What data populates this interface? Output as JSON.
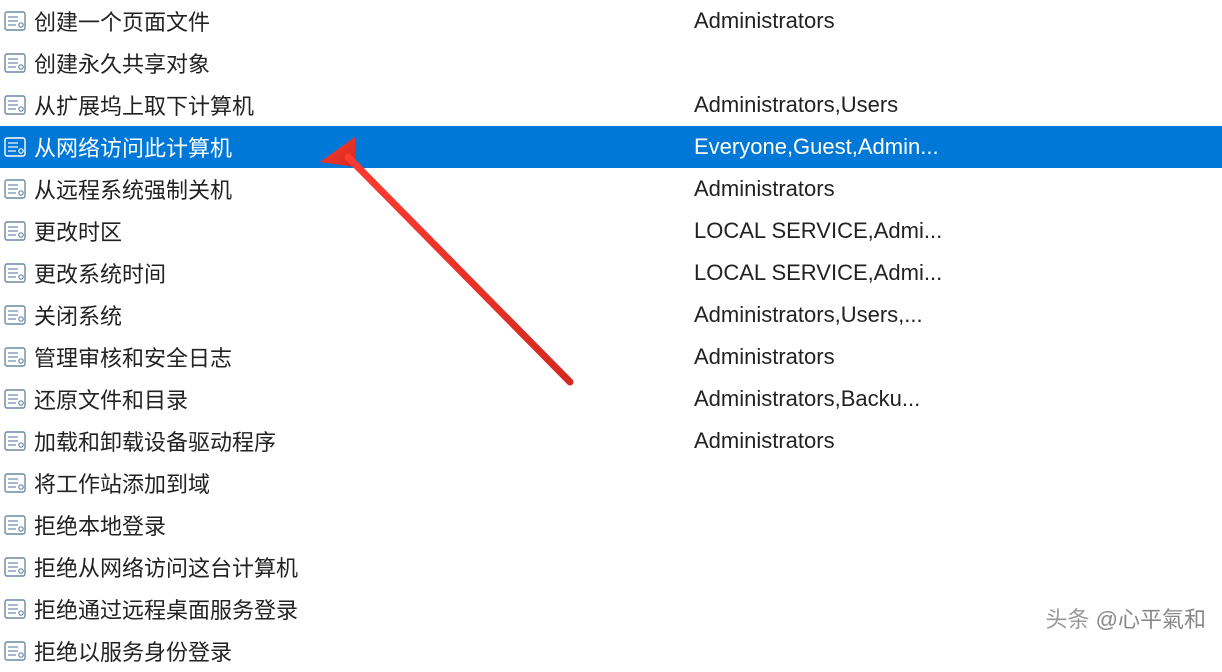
{
  "policies": [
    {
      "name": "创建一个页面文件",
      "value": "Administrators",
      "selected": false
    },
    {
      "name": "创建永久共享对象",
      "value": "",
      "selected": false
    },
    {
      "name": "从扩展坞上取下计算机",
      "value": "Administrators,Users",
      "selected": false
    },
    {
      "name": "从网络访问此计算机",
      "value": "Everyone,Guest,Admin...",
      "selected": true
    },
    {
      "name": "从远程系统强制关机",
      "value": "Administrators",
      "selected": false
    },
    {
      "name": "更改时区",
      "value": "LOCAL SERVICE,Admi...",
      "selected": false
    },
    {
      "name": "更改系统时间",
      "value": "LOCAL SERVICE,Admi...",
      "selected": false
    },
    {
      "name": "关闭系统",
      "value": "Administrators,Users,...",
      "selected": false
    },
    {
      "name": "管理审核和安全日志",
      "value": "Administrators",
      "selected": false
    },
    {
      "name": "还原文件和目录",
      "value": "Administrators,Backu...",
      "selected": false
    },
    {
      "name": "加载和卸载设备驱动程序",
      "value": "Administrators",
      "selected": false
    },
    {
      "name": "将工作站添加到域",
      "value": "",
      "selected": false
    },
    {
      "name": "拒绝本地登录",
      "value": "",
      "selected": false
    },
    {
      "name": "拒绝从网络访问这台计算机",
      "value": "",
      "selected": false
    },
    {
      "name": "拒绝通过远程桌面服务登录",
      "value": "",
      "selected": false
    },
    {
      "name": "拒绝以服务身份登录",
      "value": "",
      "selected": false
    }
  ],
  "watermark": {
    "prefix": "头条",
    "handle": "@心平氣和"
  }
}
